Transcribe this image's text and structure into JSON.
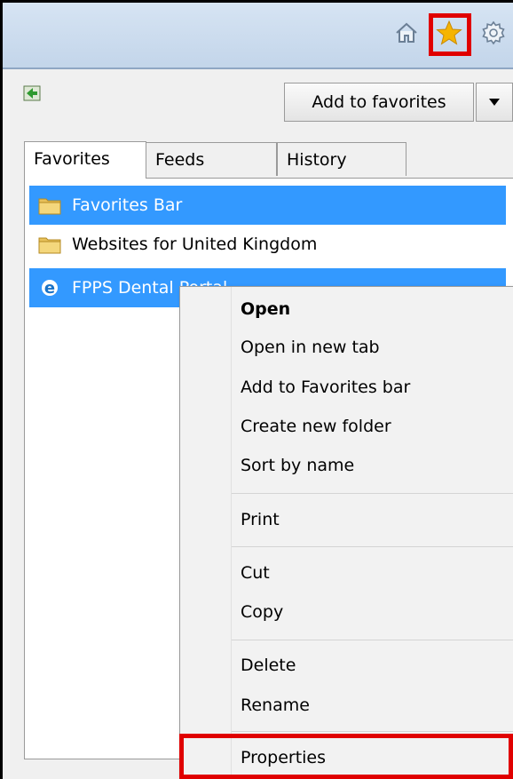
{
  "toolbar": {
    "home_icon": "home-icon",
    "favorites_icon": "star-icon",
    "tools_icon": "gear-icon"
  },
  "favorites_panel": {
    "add_button_label": "Add to favorites",
    "tabs": [
      {
        "label": "Favorites",
        "active": true
      },
      {
        "label": "Feeds",
        "active": false
      },
      {
        "label": "History",
        "active": false
      }
    ],
    "items": [
      {
        "label": "Favorites Bar",
        "icon": "folder-icon",
        "selected": true
      },
      {
        "label": "Websites for United Kingdom",
        "icon": "folder-icon",
        "selected": false
      },
      {
        "label": "FPPS Dental Portal",
        "icon": "ie-icon",
        "selected": true
      }
    ]
  },
  "context_menu": {
    "items": [
      {
        "label": "Open",
        "bold": true
      },
      {
        "label": "Open in new tab"
      },
      {
        "label": "Add to Favorites bar"
      },
      {
        "label": "Create new folder"
      },
      {
        "label": "Sort by name"
      },
      {
        "label": "Print"
      },
      {
        "label": "Cut"
      },
      {
        "label": "Copy"
      },
      {
        "label": "Delete"
      },
      {
        "label": "Rename"
      },
      {
        "label": "Properties"
      }
    ]
  },
  "colors": {
    "highlight": "#e00000",
    "selection": "#3399ff",
    "toolbar_bg": "#c9d9ec"
  }
}
